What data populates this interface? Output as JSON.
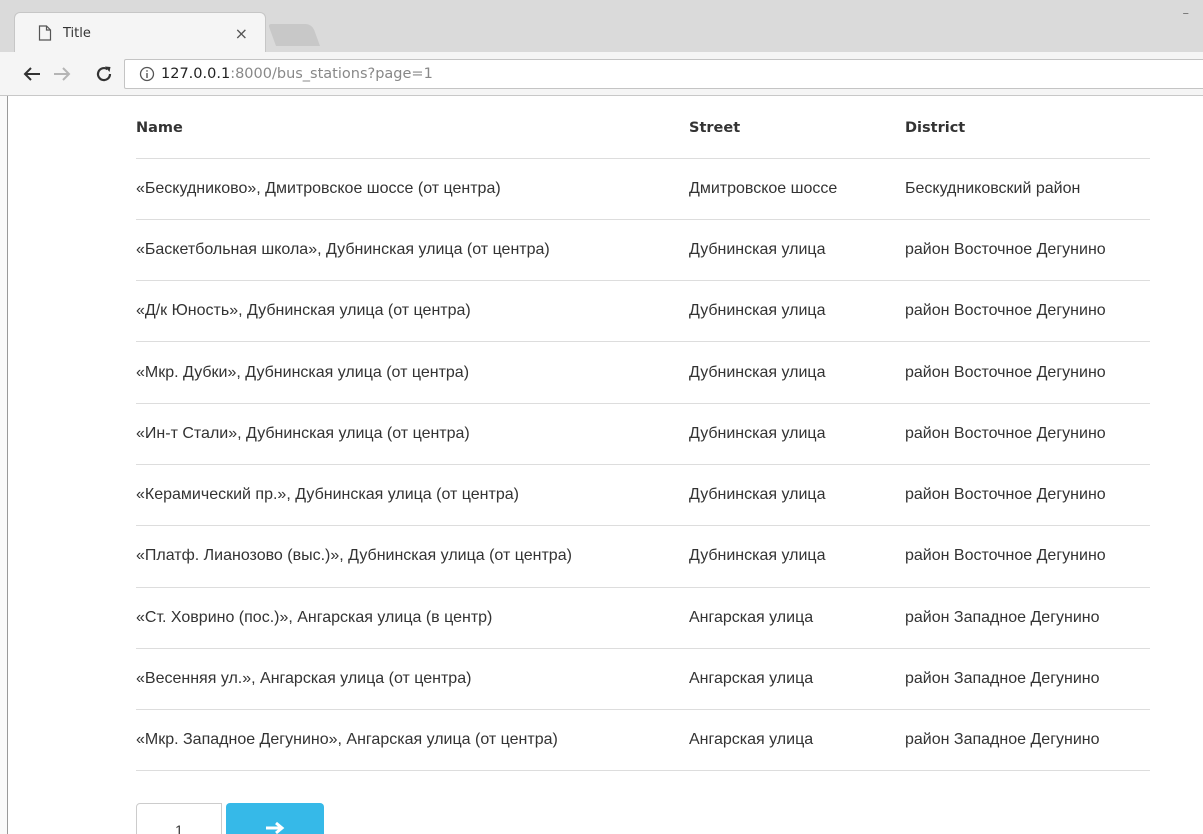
{
  "browser": {
    "tab_title": "Title",
    "tab_close": "×",
    "url_host": "127.0.0.1",
    "url_rest": ":8000/bus_stations?page=1"
  },
  "table": {
    "headers": [
      "Name",
      "Street",
      "District"
    ],
    "rows": [
      [
        "«Бескудниково», Дмитровское шоссе (от центра)",
        "Дмитровское шоссе",
        "Бескудниковский район"
      ],
      [
        "«Баскетбольная школа», Дубнинская улица (от центра)",
        "Дубнинская улица",
        "район Восточное Дегунино"
      ],
      [
        "«Д/к Юность», Дубнинская улица (от центра)",
        "Дубнинская улица",
        "район Восточное Дегунино"
      ],
      [
        "«Мкр. Дубки», Дубнинская улица (от центра)",
        "Дубнинская улица",
        "район Восточное Дегунино"
      ],
      [
        "«Ин-т Стали», Дубнинская улица (от центра)",
        "Дубнинская улица",
        "район Восточное Дегунино"
      ],
      [
        "«Керамический пр.», Дубнинская улица (от центра)",
        "Дубнинская улица",
        "район Восточное Дегунино"
      ],
      [
        "«Платф. Лианозово (выс.)», Дубнинская улица (от центра)",
        "Дубнинская улица",
        "район Восточное Дегунино"
      ],
      [
        "«Ст. Ховрино (пос.)», Ангарская улица (в центр)",
        "Ангарская улица",
        "район Западное Дегунино"
      ],
      [
        "«Весенняя ул.», Ангарская улица (от центра)",
        "Ангарская улица",
        "район Западное Дегунино"
      ],
      [
        "«Мкр. Западное Дегунино», Ангарская улица (от центра)",
        "Ангарская улица",
        "район Западное Дегунино"
      ]
    ]
  },
  "pagination": {
    "current_page": "1"
  },
  "colors": {
    "next_button": "#36b9e8",
    "row_border": "#dddddd"
  }
}
